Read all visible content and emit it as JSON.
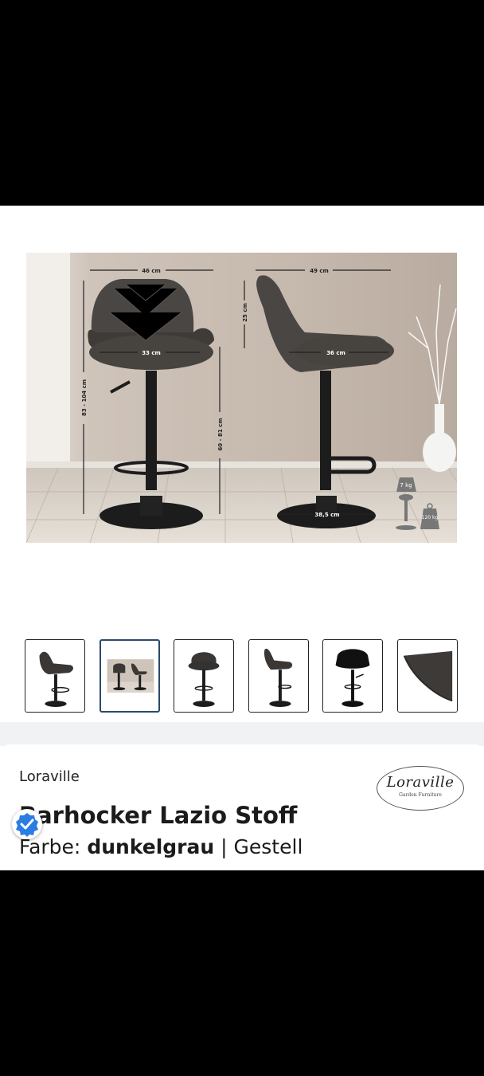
{
  "product": {
    "brand": "Loraville",
    "title": "Barhocker Lazio Stoff",
    "variant_label": "Farbe:",
    "variant_value": "dunkelgrau",
    "variant_separator": "|",
    "variant_more": "Gestell"
  },
  "logo": {
    "name": "Loraville",
    "tagline": "Garden Furniture"
  },
  "image": {
    "dimensions": {
      "width_front": "46 cm",
      "width_side": "49 cm",
      "backrest": "25 cm",
      "seat_front": "33 cm",
      "seat_side": "36 cm",
      "total_height": "83 - 104 cm",
      "seat_height": "60 - 81 cm",
      "base": "38,5 cm",
      "weight": "7 kg",
      "load": "120 kg"
    }
  },
  "thumbnails": [
    {
      "name": "thumb-side-view",
      "selected": false
    },
    {
      "name": "thumb-dimensions",
      "selected": true
    },
    {
      "name": "thumb-front-view",
      "selected": false
    },
    {
      "name": "thumb-side-view-2",
      "selected": false
    },
    {
      "name": "thumb-front-view-2",
      "selected": false
    },
    {
      "name": "thumb-fabric-detail",
      "selected": false
    }
  ],
  "colors": {
    "upholstery": "#4a4643",
    "frame": "#1c1c1c",
    "wall": "#c9beb4",
    "floor": "#d8d0c6",
    "selected_border": "#2b4a6b",
    "badge": "#2a7de1"
  }
}
